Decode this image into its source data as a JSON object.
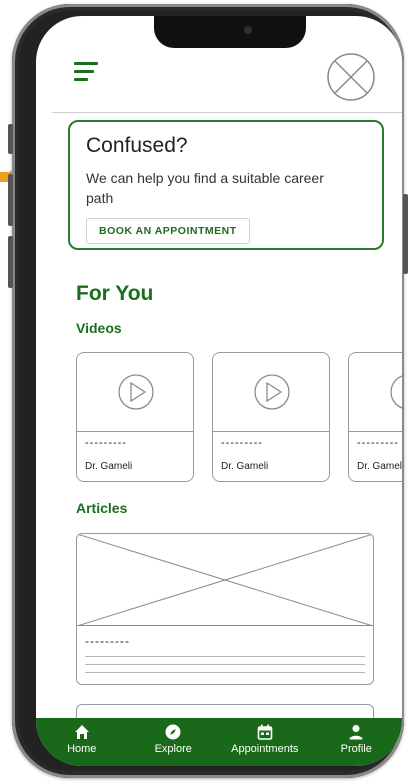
{
  "header": {
    "menu_icon": "hamburger-icon",
    "avatar_icon": "avatar-placeholder-icon"
  },
  "promo": {
    "title": "Confused?",
    "text": "We can help you find a suitable career path",
    "button": "BOOK AN APPOINTMENT"
  },
  "section_title": "For You",
  "videos": {
    "heading": "Videos",
    "items": [
      {
        "title": "---------",
        "author": "Dr. Gameli"
      },
      {
        "title": "---------",
        "author": "Dr. Gameli"
      },
      {
        "title": "---------",
        "author": "Dr. Gameli"
      }
    ]
  },
  "articles": {
    "heading": "Articles",
    "items": [
      {
        "title": "---------"
      }
    ]
  },
  "nav": {
    "items": [
      {
        "label": "Home",
        "icon": "home-icon"
      },
      {
        "label": "Explore",
        "icon": "compass-icon"
      },
      {
        "label": "Appointments",
        "icon": "calendar-icon"
      },
      {
        "label": "Profile",
        "icon": "user-icon"
      }
    ]
  },
  "colors": {
    "brand_green": "#1b6e1b",
    "nav_bg": "#1a691a",
    "annotation_arrow": "#f0a020"
  }
}
